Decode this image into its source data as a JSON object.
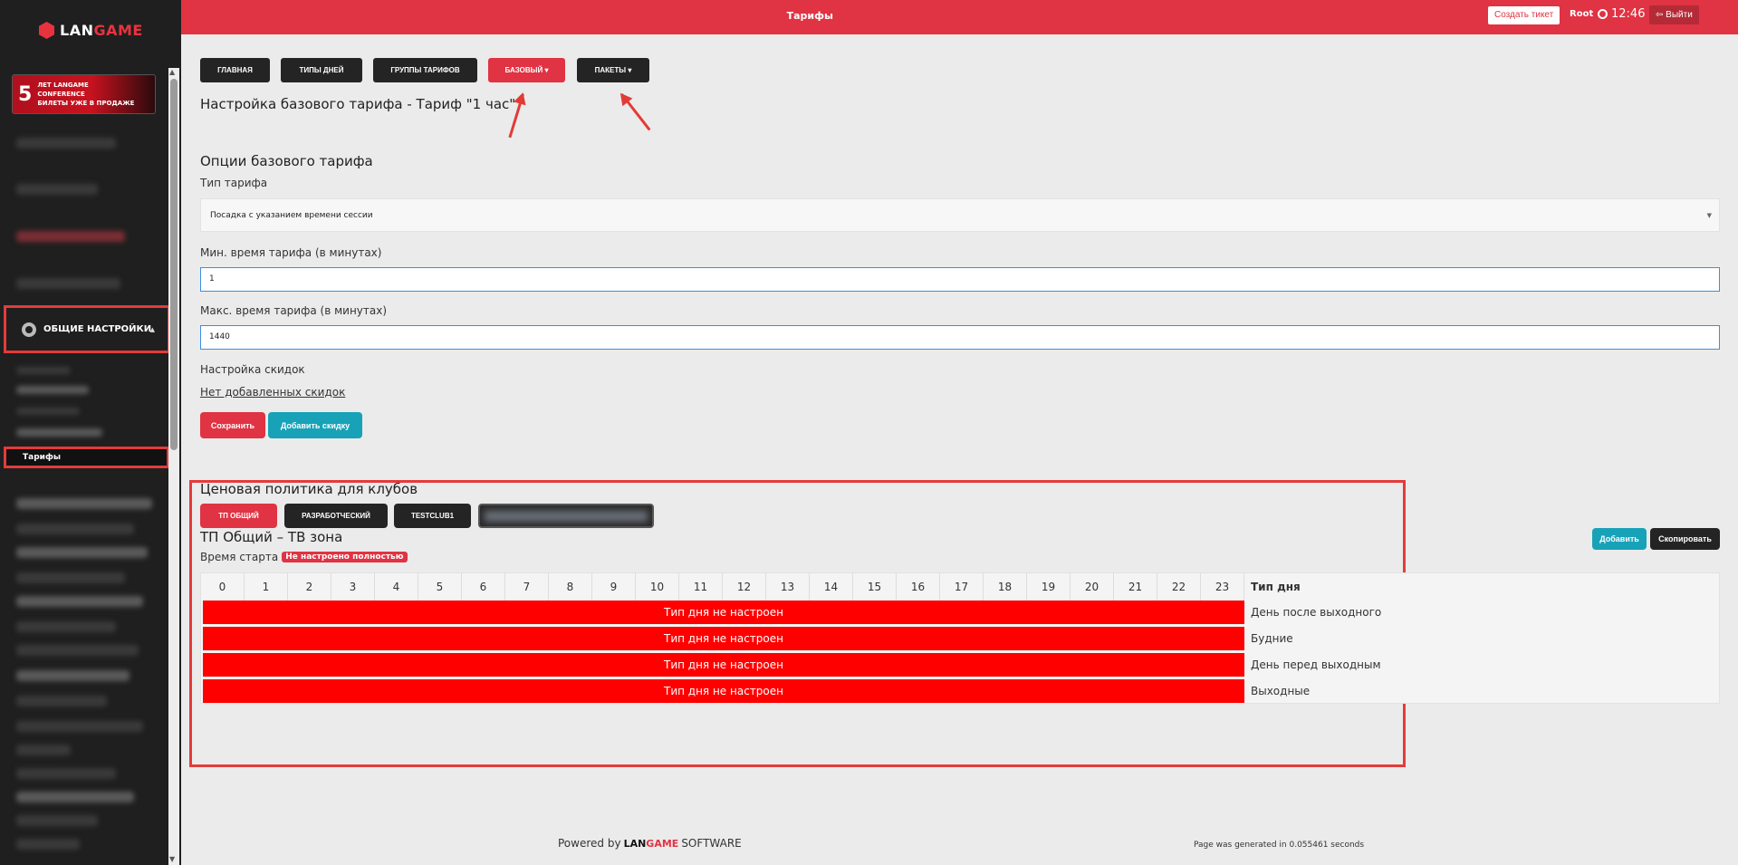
{
  "brand": {
    "logo_left": "LAN",
    "logo_right": "GAME"
  },
  "sidebar": {
    "promo": {
      "number": "5",
      "lines": [
        "ЛЕТ LANGAME",
        "CONFERENCE",
        "БИЛЕТЫ УЖЕ В ПРОДАЖЕ"
      ]
    },
    "general_settings_label": "ОБЩИЕ НАСТРОЙКИ",
    "tariffs_label": "Тарифы"
  },
  "topbar": {
    "title": "Тарифы",
    "create_ticket": "Создать тикет",
    "user": "Root",
    "time": "12:46",
    "logout": "Выйти"
  },
  "tabs": [
    {
      "label": "ГЛАВНАЯ",
      "active": false
    },
    {
      "label": "ТИПЫ ДНЕЙ",
      "active": false
    },
    {
      "label": "ГРУППЫ ТАРИФОВ",
      "active": false
    },
    {
      "label": "БАЗОВЫЙ ▾",
      "active": true
    },
    {
      "label": "ПАКЕТЫ ▾",
      "active": false
    }
  ],
  "page_title": "Настройка базового тарифа - Тариф \"1 час\"",
  "options": {
    "heading": "Опции базового тарифа",
    "type_label": "Тип тарифа",
    "type_value": "Посадка с указанием времени сессии",
    "min_label": "Мин. время тарифа (в минутах)",
    "min_value": "1",
    "max_label": "Макс. время тарифа (в минутах)",
    "max_value": "1440",
    "discounts_label": "Настройка скидок",
    "no_discounts": "Нет добавленных скидок",
    "save": "Сохранить",
    "add_discount": "Добавить скидку"
  },
  "pricing": {
    "heading": "Ценовая политика для клубов",
    "clubs": [
      "ТП ОБЩИЙ",
      "РАЗРАБОТЧЕСКИЙ",
      "TESTCLUB1"
    ],
    "zone_title": "ТП Общий – ТВ зона",
    "start_label": "Время старта",
    "start_badge": "Не настроено полностью",
    "add": "Добавить",
    "copy": "Скопировать",
    "hours": [
      "0",
      "1",
      "2",
      "3",
      "4",
      "5",
      "6",
      "7",
      "8",
      "9",
      "10",
      "11",
      "12",
      "13",
      "14",
      "15",
      "16",
      "17",
      "18",
      "19",
      "20",
      "21",
      "22",
      "23"
    ],
    "day_type_header": "Тип дня",
    "rows": [
      {
        "status": "Тип дня не настроен",
        "day_type": "День после выходного"
      },
      {
        "status": "Тип дня не настроен",
        "day_type": "Будние"
      },
      {
        "status": "Тип дня не настроен",
        "day_type": "День перед выходным"
      },
      {
        "status": "Тип дня не настроен",
        "day_type": "Выходные"
      }
    ]
  },
  "footer": {
    "powered_by": "Powered by",
    "brand_left": "LAN",
    "brand_right": "GAME",
    "software": "SOFTWARE",
    "generated": "Page was generated in 0.055461 seconds"
  }
}
